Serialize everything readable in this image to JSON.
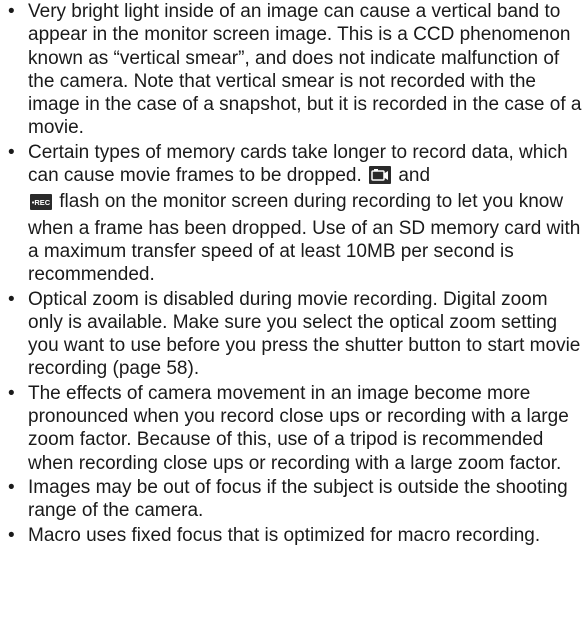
{
  "bullet_symbol": "•",
  "items": [
    {
      "text": "Very bright light inside of an image can cause a vertical band to appear in the monitor screen image. This is a CCD phenomenon known as “vertical smear”, and does not indicate malfunction of the camera. Note that vertical smear is not recorded with the image in the case of a snapshot, but it is recorded in the case of a movie."
    },
    {
      "text_before_icons": "Certain types of memory cards take longer to record data, which can cause movie frames to be dropped.",
      "icon_1": "camera-card-icon",
      "connector": "and",
      "icon_2": "rec-icon",
      "icon_2_label": "•REC",
      "text_after_icons": "flash on the monitor screen during recording to let you know when a frame has been dropped. Use of an SD memory card with a maximum transfer speed of at least 10MB per second is recommended."
    },
    {
      "text": "Optical zoom is disabled during movie recording. Digital zoom only is available. Make sure you select the optical zoom setting you want to use before you press the shutter button to start movie recording (page 58)."
    },
    {
      "text": "The effects of camera movement in an image become more pronounced when you record close ups or recording with a large zoom factor. Because of this, use of a tripod is recommended when recording close ups or recording with a large zoom factor."
    },
    {
      "text": "Images may be out of focus if the subject is outside the shooting range of the camera."
    },
    {
      "text": "Macro uses fixed focus that is optimized for macro recording."
    }
  ],
  "colors": {
    "text": "#1a1a1a",
    "icon_fill": "#2a2a2a",
    "icon_text": "#ffffff"
  }
}
